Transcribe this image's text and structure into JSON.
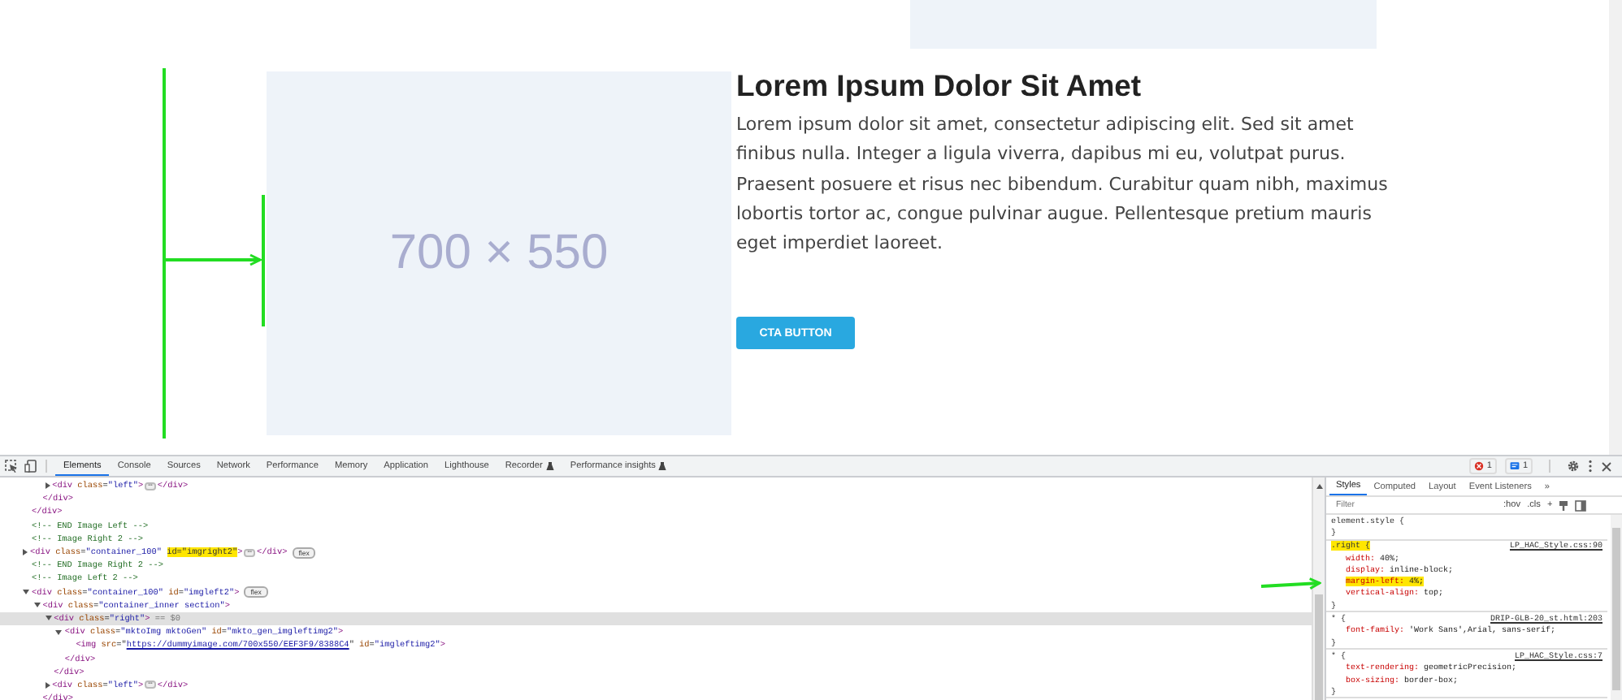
{
  "page": {
    "image_label": "700 × 550",
    "heading": "Lorem Ipsum Dolor Sit Amet",
    "paragraph": "Lorem ipsum dolor sit amet, consectetur adipiscing elit. Sed sit amet finibus nulla. Integer a ligula viverra, dapibus mi eu, volutpat purus. Praesent posuere et risus nec bibendum. Curabitur quam nibh, maximus lobortis tortor ac, congue pulvinar augue. Pellentesque pretium mauris eget imperdiet laoreet.",
    "button": "CTA BUTTON"
  },
  "devtools": {
    "tabs": [
      {
        "label": "Elements",
        "selected": true,
        "kind": "plain"
      },
      {
        "label": "Console",
        "selected": false,
        "kind": "plain"
      },
      {
        "label": "Sources",
        "selected": false,
        "kind": "plain"
      },
      {
        "label": "Network",
        "selected": false,
        "kind": "plain"
      },
      {
        "label": "Performance",
        "selected": false,
        "kind": "plain"
      },
      {
        "label": "Memory",
        "selected": false,
        "kind": "plain"
      },
      {
        "label": "Application",
        "selected": false,
        "kind": "plain"
      },
      {
        "label": "Lighthouse",
        "selected": false,
        "kind": "plain"
      },
      {
        "label": "Recorder",
        "selected": false,
        "kind": "experimental"
      },
      {
        "label": "Performance insights",
        "selected": false,
        "kind": "experimental"
      }
    ],
    "error_count": "1",
    "message_count": "1",
    "dom_tree": [
      {
        "closing": [
          {
            "kind": "tag",
            "text": "</div>"
          }
        ],
        "children": [
          {
            "closing": [
              {
                "kind": "tag",
                "text": "</div>"
              }
            ],
            "children": [
              {
                "selected": false,
                "expanded": false,
                "tokens": [
                  {
                    "kind": "tag",
                    "text": "<div"
                  },
                  {
                    "kind": "attr",
                    "text": " class"
                  },
                  {
                    "kind": "punct",
                    "text": "="
                  },
                  {
                    "kind": "value",
                    "text": "\"left\""
                  },
                  {
                    "kind": "tag",
                    "text": ">"
                  },
                  {
                    "kind": "ellipsis",
                    "text": "⋯"
                  },
                  {
                    "kind": "tag",
                    "text": "</div>"
                  }
                ]
              }
            ]
          }
        ]
      },
      {
        "selected": false,
        "tokens": [
          {
            "kind": "comment",
            "text": "<!-- END Image Left -->"
          }
        ]
      },
      {
        "selected": false,
        "tokens": [
          {
            "kind": "comment",
            "text": "<!-- Image Right 2 -->"
          }
        ]
      },
      {
        "selected": false,
        "expanded": false,
        "tokens": [
          {
            "kind": "tag",
            "text": "<div"
          },
          {
            "kind": "attr",
            "text": " class"
          },
          {
            "kind": "punct",
            "text": "="
          },
          {
            "kind": "value",
            "text": "\"container_100\" "
          },
          {
            "kind": "mark",
            "text": "id=\"imgright2\""
          },
          {
            "kind": "tag",
            "text": ">"
          },
          {
            "kind": "ellipsis",
            "text": "⋯"
          },
          {
            "kind": "tag",
            "text": "</div>"
          },
          {
            "kind": "badge",
            "text": "flex"
          }
        ]
      },
      {
        "selected": false,
        "tokens": [
          {
            "kind": "comment",
            "text": "<!-- END Image Right 2 -->"
          }
        ]
      },
      {
        "selected": false,
        "tokens": [
          {
            "kind": "comment",
            "text": "<!-- Image Left 2 -->"
          }
        ]
      },
      {
        "selected": false,
        "expanded": true,
        "tokens": [
          {
            "kind": "tag",
            "text": "<div"
          },
          {
            "kind": "attr",
            "text": " class"
          },
          {
            "kind": "punct",
            "text": "="
          },
          {
            "kind": "value",
            "text": "\"container_100\""
          },
          {
            "kind": "attr",
            "text": " id"
          },
          {
            "kind": "punct",
            "text": "="
          },
          {
            "kind": "value",
            "text": "\"imgleft2\""
          },
          {
            "kind": "tag",
            "text": ">"
          },
          {
            "kind": "badge",
            "text": "flex"
          }
        ],
        "children": [
          {
            "selected": false,
            "expanded": true,
            "tokens": [
              {
                "kind": "tag",
                "text": "<div"
              },
              {
                "kind": "attr",
                "text": " class"
              },
              {
                "kind": "punct",
                "text": "="
              },
              {
                "kind": "value",
                "text": "\"container_inner section\""
              },
              {
                "kind": "tag",
                "text": ">"
              }
            ],
            "closing": [
              {
                "kind": "tag",
                "text": "</div>"
              }
            ],
            "children": [
              {
                "selected": true,
                "expanded": true,
                "tokens": [
                  {
                    "kind": "tag",
                    "text": "<div"
                  },
                  {
                    "kind": "attr",
                    "text": " class"
                  },
                  {
                    "kind": "punct",
                    "text": "="
                  },
                  {
                    "kind": "value",
                    "text": "\"right\""
                  },
                  {
                    "kind": "tag",
                    "text": ">"
                  },
                  {
                    "kind": "ref",
                    "text": " == $0"
                  }
                ],
                "closing": [
                  {
                    "kind": "tag",
                    "text": "</div>"
                  }
                ],
                "children": [
                  {
                    "selected": false,
                    "expanded": true,
                    "tokens": [
                      {
                        "kind": "tag",
                        "text": "<div"
                      },
                      {
                        "kind": "attr",
                        "text": " class"
                      },
                      {
                        "kind": "punct",
                        "text": "="
                      },
                      {
                        "kind": "value",
                        "text": "\"mktoImg mktoGen\""
                      },
                      {
                        "kind": "attr",
                        "text": " id"
                      },
                      {
                        "kind": "punct",
                        "text": "="
                      },
                      {
                        "kind": "value",
                        "text": "\"mkto_gen_imgleftimg2\""
                      },
                      {
                        "kind": "tag",
                        "text": ">"
                      }
                    ],
                    "closing": [
                      {
                        "kind": "tag",
                        "text": "</div>"
                      }
                    ],
                    "children": [
                      {
                        "selected": false,
                        "tokens": [
                          {
                            "kind": "tag",
                            "text": "<img"
                          },
                          {
                            "kind": "attr",
                            "text": " src"
                          },
                          {
                            "kind": "punct",
                            "text": "=\""
                          },
                          {
                            "kind": "link",
                            "text": "https://dummyimage.com/700x550/EEF3F9/8388C4"
                          },
                          {
                            "kind": "punct",
                            "text": "\""
                          },
                          {
                            "kind": "attr",
                            "text": " id"
                          },
                          {
                            "kind": "punct",
                            "text": "="
                          },
                          {
                            "kind": "value",
                            "text": "\"imgleftimg2\""
                          },
                          {
                            "kind": "tag",
                            "text": ">"
                          }
                        ]
                      }
                    ]
                  }
                ]
              },
              {
                "selected": false,
                "expanded": false,
                "tokens": [
                  {
                    "kind": "tag",
                    "text": "<div"
                  },
                  {
                    "kind": "attr",
                    "text": " class"
                  },
                  {
                    "kind": "punct",
                    "text": "="
                  },
                  {
                    "kind": "value",
                    "text": "\"left\""
                  },
                  {
                    "kind": "tag",
                    "text": ">"
                  },
                  {
                    "kind": "ellipsis",
                    "text": "⋯"
                  },
                  {
                    "kind": "tag",
                    "text": "</div>"
                  }
                ]
              }
            ]
          }
        ]
      }
    ],
    "styles_tabs": [
      {
        "label": "Styles",
        "selected": true
      },
      {
        "label": "Computed",
        "selected": false
      },
      {
        "label": "Layout",
        "selected": false
      },
      {
        "label": "Event Listeners",
        "selected": false
      },
      {
        "label": "»",
        "selected": false
      }
    ],
    "filter_placeholder": "Filter",
    "hov": ":hov",
    "cls": ".cls",
    "add": "+",
    "rules": [
      {
        "selector": "element.style {",
        "highlighted": false,
        "close": "}"
      },
      {
        "selector": ".right {",
        "highlighted": true,
        "source": "LP_HAC_Style.css:90",
        "close": "}",
        "declarations": [
          {
            "property": "width:",
            "value": "40%;",
            "highlighted": false
          },
          {
            "property": "display:",
            "value": "inline-block;",
            "highlighted": false
          },
          {
            "property": "margin-left:",
            "value": "4%;",
            "highlighted": true
          },
          {
            "property": "vertical-align:",
            "value": "top;",
            "highlighted": false
          }
        ]
      },
      {
        "selector": "* {",
        "highlighted": false,
        "source": "DRIP-GLB-20_st.html:203",
        "close": "}",
        "declarations": [
          {
            "property": "font-family:",
            "value": "'Work Sans',Arial, sans-serif;",
            "highlighted": false
          }
        ]
      },
      {
        "selector": "* {",
        "highlighted": false,
        "source": "LP_HAC_Style.css:7",
        "close": "}",
        "declarations": [
          {
            "property": "text-rendering:",
            "value": "geometricPrecision;",
            "highlighted": false
          },
          {
            "property": "box-sizing:",
            "value": "border-box;",
            "highlighted": false
          }
        ]
      }
    ]
  }
}
